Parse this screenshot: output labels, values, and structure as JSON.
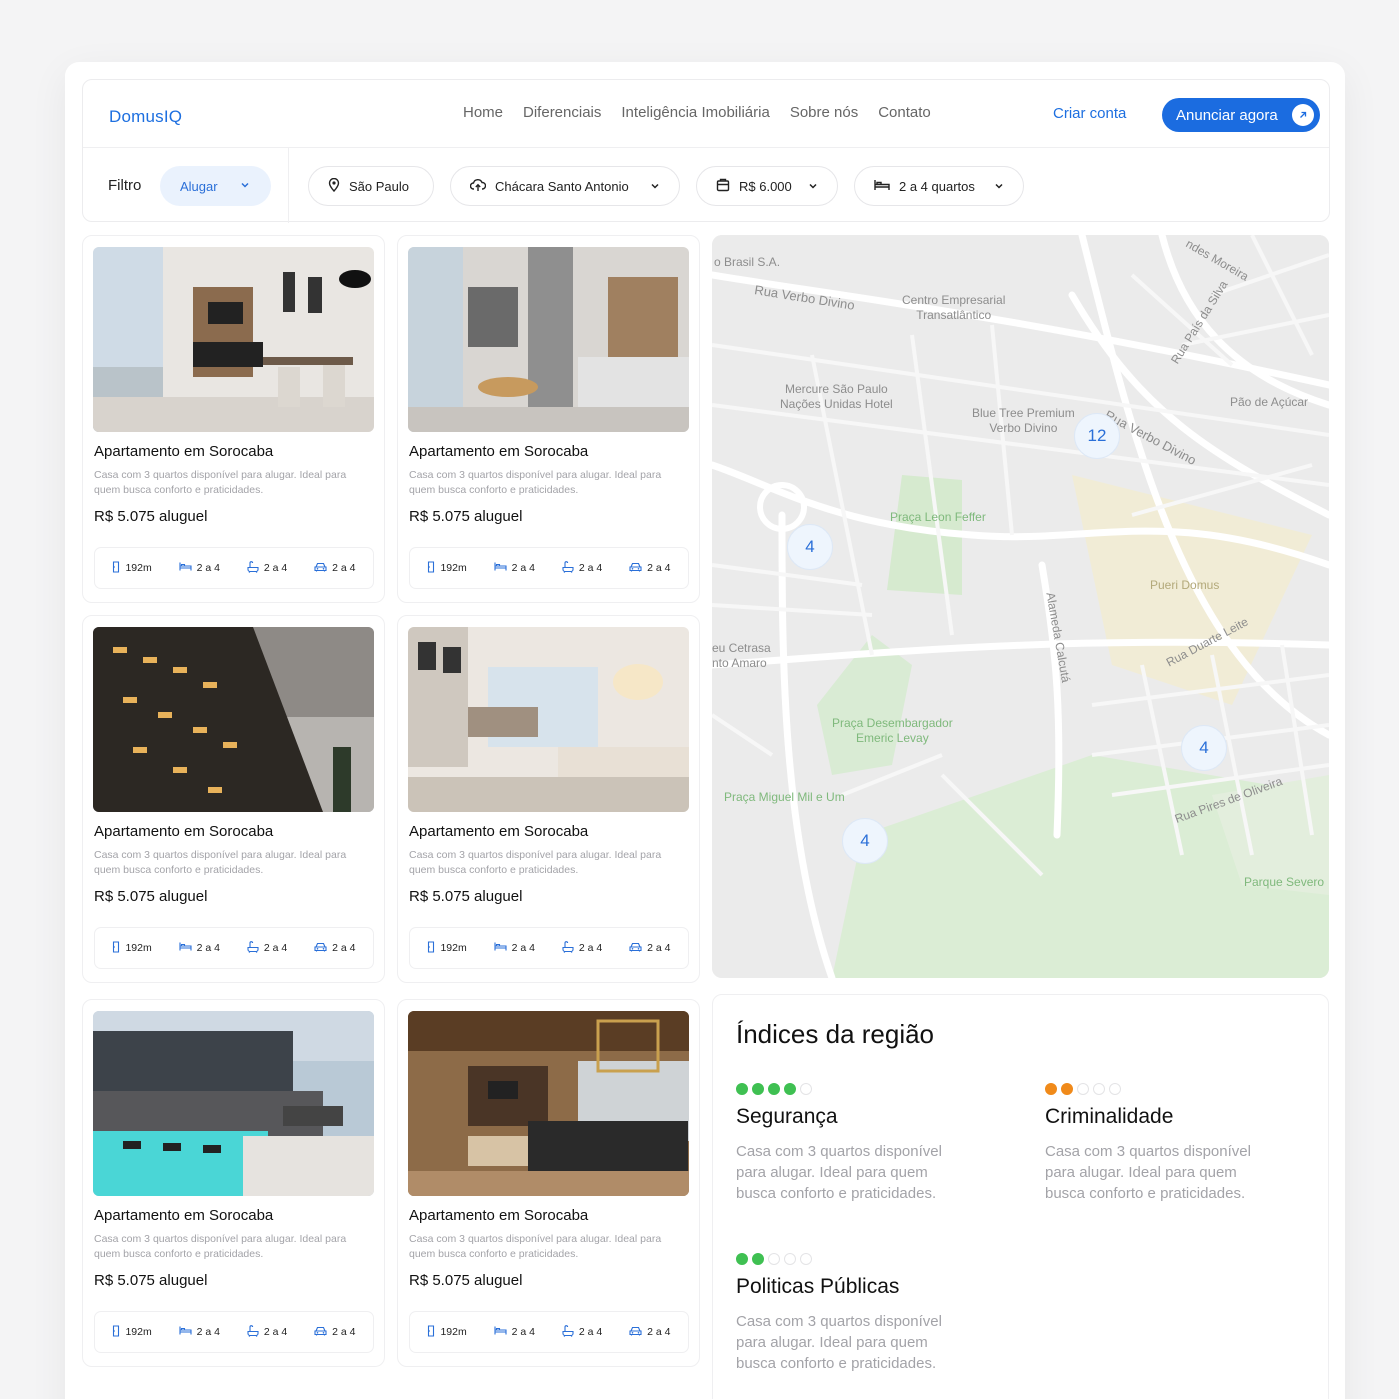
{
  "brand": "DomusIQ",
  "nav": {
    "items": [
      "Home",
      "Diferenciais",
      "Inteligência Imobiliária",
      "Sobre nós",
      "Contato"
    ],
    "signup": "Criar conta",
    "cta": "Anunciar agora"
  },
  "filters": {
    "label": "Filtro",
    "mode": "Alugar",
    "city": "São Paulo",
    "neighborhood": "Chácara Santo Antonio",
    "price": "R$ 6.000",
    "rooms": "2 a 4 quartos"
  },
  "listings": [
    {
      "title": "Apartamento em Sorocaba",
      "description": "Casa com 3 quartos disponível para alugar. Ideal para quem busca conforto e praticidades.",
      "price": "R$ 5.075 aluguel",
      "area": "192m",
      "bedrooms": "2 a 4",
      "bathrooms": "2 a 4",
      "parking": "2 a 4"
    },
    {
      "title": "Apartamento em Sorocaba",
      "description": "Casa com 3 quartos disponível para alugar. Ideal para quem busca conforto e praticidades.",
      "price": "R$ 5.075 aluguel",
      "area": "192m",
      "bedrooms": "2 a 4",
      "bathrooms": "2 a 4",
      "parking": "2 a 4"
    },
    {
      "title": "Apartamento em Sorocaba",
      "description": "Casa com 3 quartos disponível para alugar. Ideal para quem busca conforto e praticidades.",
      "price": "R$ 5.075 aluguel",
      "area": "192m",
      "bedrooms": "2 a 4",
      "bathrooms": "2 a 4",
      "parking": "2 a 4"
    },
    {
      "title": "Apartamento em Sorocaba",
      "description": "Casa com 3 quartos disponível para alugar. Ideal para quem busca conforto e praticidades.",
      "price": "R$ 5.075 aluguel",
      "area": "192m",
      "bedrooms": "2 a 4",
      "bathrooms": "2 a 4",
      "parking": "2 a 4"
    },
    {
      "title": "Apartamento em Sorocaba",
      "description": "Casa com 3 quartos disponível para alugar. Ideal para quem busca conforto e praticidades.",
      "price": "R$ 5.075 aluguel",
      "area": "192m",
      "bedrooms": "2 a 4",
      "bathrooms": "2 a 4",
      "parking": "2 a 4"
    },
    {
      "title": "Apartamento em Sorocaba",
      "description": "Casa com 3 quartos disponível para alugar. Ideal para quem busca conforto e praticidades.",
      "price": "R$ 5.075 aluguel",
      "area": "192m",
      "bedrooms": "2 a 4",
      "bathrooms": "2 a 4",
      "parking": "2 a 4"
    }
  ],
  "map": {
    "labels": [
      "o Brasil S.A.",
      "Rua Verbo Divino",
      "Centro Empresarial\nTransatlântico",
      "ndes Moreira",
      "Rua País da Silva",
      "Mercure São Paulo\nNações Unidas Hotel",
      "Blue Tree Premium\nVerbo Divino",
      "Rua Verbo Divino",
      "Pão de Açúcar",
      "Praça Leon Feffer",
      "Pueri Domus",
      "Alameda Calcutá",
      "eu Cetrasa\nnto Amaro",
      "Rua Duarte Leite",
      "Praça Desembargador\nEmeric Levay",
      "Praça Miguel Mil e Um",
      "Rua Pires de Oliveira",
      "Parque Severo"
    ],
    "clusters": [
      "12",
      "4",
      "4",
      "4"
    ]
  },
  "indices": {
    "title": "Índices da região",
    "items": [
      {
        "name": "Segurança",
        "description": "Casa com 3 quartos disponível para alugar. Ideal para quem busca conforto e praticidades.",
        "level": 4,
        "max": 5,
        "color": "#3fc052"
      },
      {
        "name": "Criminalidade",
        "description": "Casa com 3 quartos disponível para alugar. Ideal para quem busca conforto e praticidades.",
        "level": 2,
        "max": 5,
        "color": "#f08a1a"
      },
      {
        "name": "Politicas Públicas",
        "description": "Casa com 3 quartos disponível para alugar. Ideal para quem busca conforto e praticidades.",
        "level": 2,
        "max": 5,
        "color": "#3fc052"
      }
    ]
  },
  "colors": {
    "accent": "#1b6ce0",
    "accentSoft": "#eaf2fd"
  }
}
